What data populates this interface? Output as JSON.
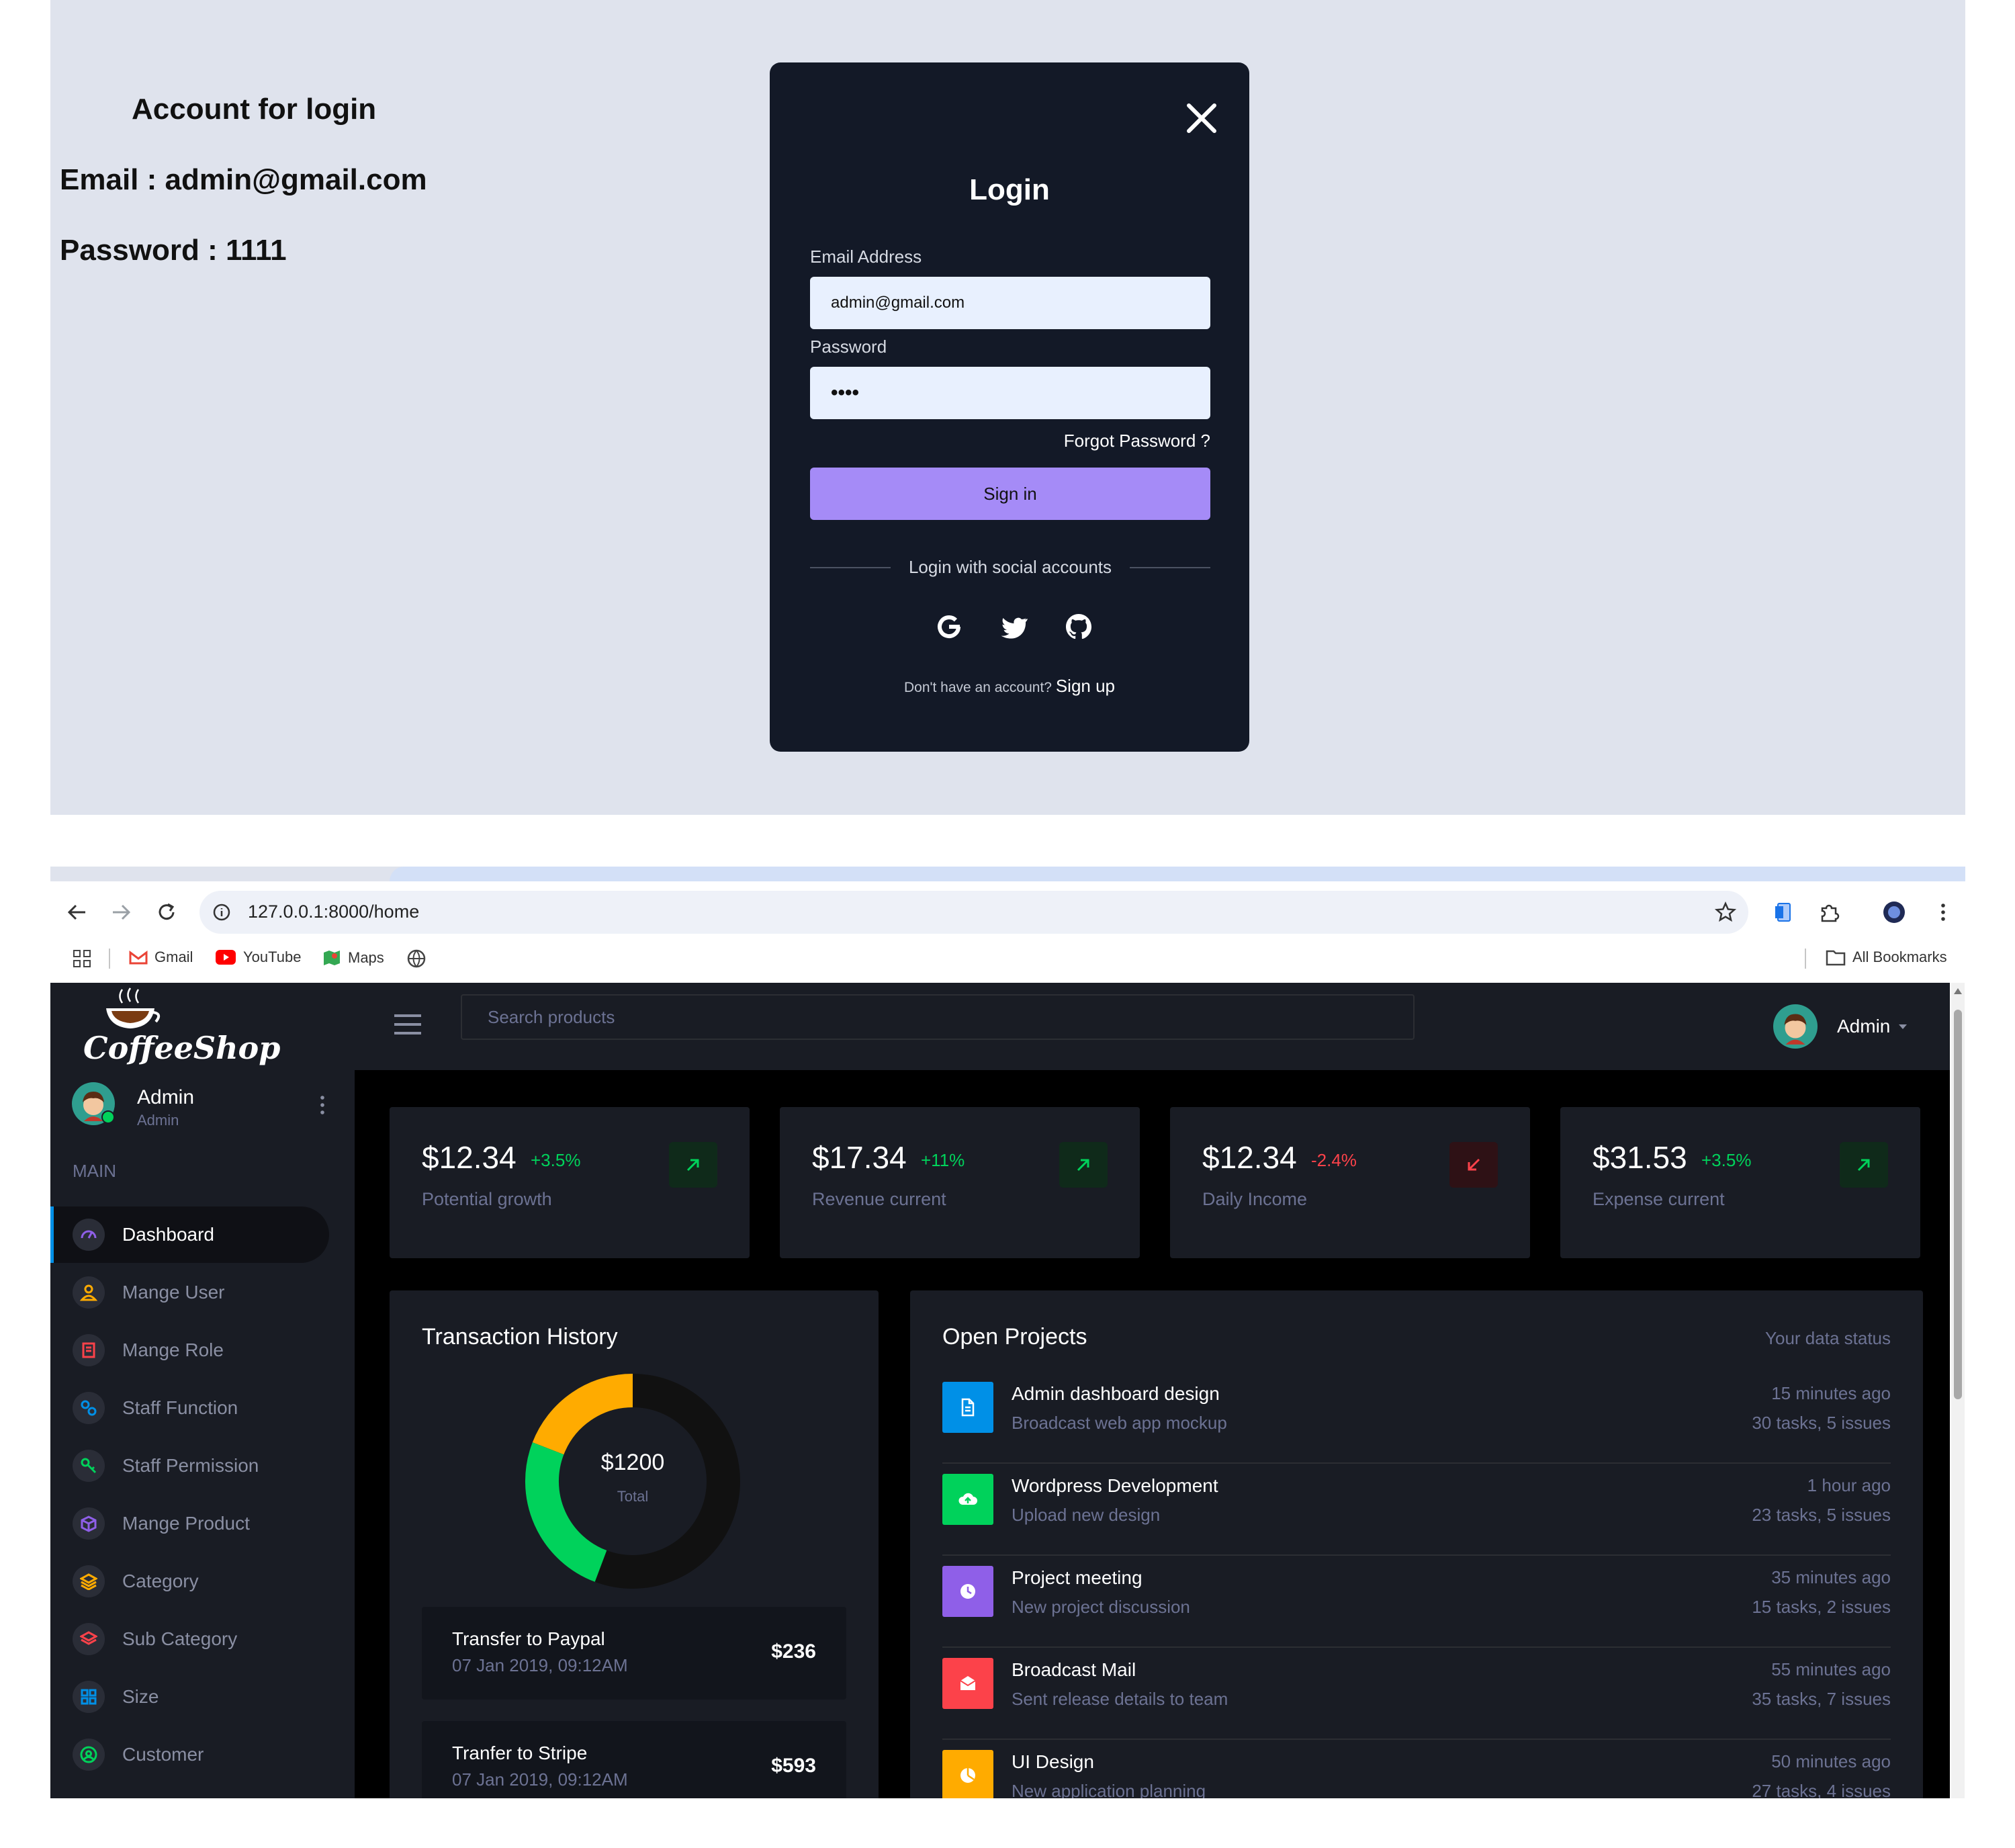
{
  "account_info": {
    "title": "Account for login",
    "email": "Email : admin@gmail.com",
    "password": "Password : 1111"
  },
  "login_modal": {
    "title": "Login",
    "email_label": "Email Address",
    "email_value": "admin@gmail.com",
    "password_label": "Password",
    "password_value": "••••",
    "forgot": "Forgot Password ?",
    "signin": "Sign in",
    "social_text": "Login with social accounts",
    "social_icons": [
      "google-icon",
      "twitter-icon",
      "github-icon"
    ],
    "no_account": "Don't have an account?",
    "signup": "Sign up"
  },
  "browser": {
    "url": "127.0.0.1:8000/home",
    "bookmarks": [
      "Gmail",
      "YouTube",
      "Maps"
    ],
    "all_bookmarks": "All Bookmarks"
  },
  "app": {
    "brand": "CoffeeShop",
    "user_name": "Admin",
    "user_role": "Admin",
    "section_label": "MAIN",
    "search_placeholder": "Search products",
    "top_user": "Admin",
    "nav": [
      {
        "label": "Dashboard",
        "icon": "speedometer-icon",
        "color": "#8f5fe8"
      },
      {
        "label": "Mange User",
        "icon": "user-icon",
        "color": "#ffab00"
      },
      {
        "label": "Mange Role",
        "icon": "role-icon",
        "color": "#fc424a"
      },
      {
        "label": "Staff Function",
        "icon": "gears-icon",
        "color": "#0090e7"
      },
      {
        "label": "Staff Permission",
        "icon": "key-icon",
        "color": "#00d25b"
      },
      {
        "label": "Mange Product",
        "icon": "box-icon",
        "color": "#8f5fe8"
      },
      {
        "label": "Category",
        "icon": "layers-icon",
        "color": "#ffab00"
      },
      {
        "label": "Sub Category",
        "icon": "stack-icon",
        "color": "#fc424a"
      },
      {
        "label": "Size",
        "icon": "size-icon",
        "color": "#0090e7"
      },
      {
        "label": "Customer",
        "icon": "customer-icon",
        "color": "#00d25b"
      }
    ],
    "stats": [
      {
        "value": "$12.34",
        "pct": "+3.5%",
        "caption": "Potential growth",
        "trend": "up"
      },
      {
        "value": "$17.34",
        "pct": "+11%",
        "caption": "Revenue current",
        "trend": "up"
      },
      {
        "value": "$12.34",
        "pct": "-2.4%",
        "caption": "Daily Income",
        "trend": "down"
      },
      {
        "value": "$31.53",
        "pct": "+3.5%",
        "caption": "Expense current",
        "trend": "up"
      }
    ],
    "transactions": {
      "title": "Transaction History",
      "donut_total": "$1200",
      "donut_label": "Total",
      "items": [
        {
          "title": "Transfer to Paypal",
          "date": "07 Jan 2019, 09:12AM",
          "amount": "$236"
        },
        {
          "title": "Tranfer to Stripe",
          "date": "07 Jan 2019, 09:12AM",
          "amount": "$593"
        }
      ]
    },
    "projects": {
      "title": "Open Projects",
      "status": "Your data status",
      "items": [
        {
          "title": "Admin dashboard design",
          "sub": "Broadcast web app mockup",
          "time": "15 minutes ago",
          "meta": "30 tasks, 5 issues",
          "color": "#0090e7",
          "icon": "file-icon"
        },
        {
          "title": "Wordpress Development",
          "sub": "Upload new design",
          "time": "1 hour ago",
          "meta": "23 tasks, 5 issues",
          "color": "#00d25b",
          "icon": "cloud-upload-icon"
        },
        {
          "title": "Project meeting",
          "sub": "New project discussion",
          "time": "35 minutes ago",
          "meta": "15 tasks, 2 issues",
          "color": "#8f5fe8",
          "icon": "clock-icon"
        },
        {
          "title": "Broadcast Mail",
          "sub": "Sent release details to team",
          "time": "55 minutes ago",
          "meta": "35 tasks, 7 issues",
          "color": "#fc424a",
          "icon": "mail-icon"
        },
        {
          "title": "UI Design",
          "sub": "New application planning",
          "time": "50 minutes ago",
          "meta": "27 tasks, 4 issues",
          "color": "#ffab00",
          "icon": "chart-pie-icon"
        }
      ]
    }
  }
}
